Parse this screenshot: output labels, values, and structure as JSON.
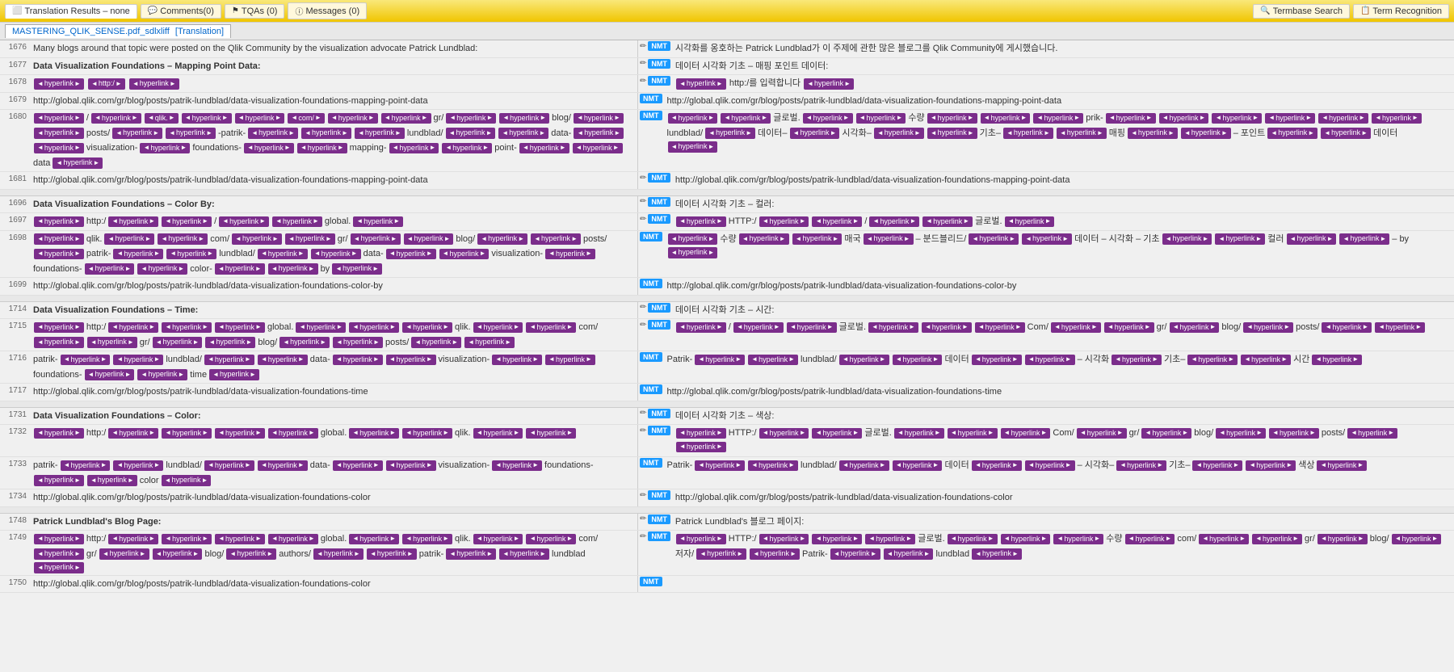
{
  "toolbar": {
    "translation_results_label": "Translation Results",
    "translation_results_value": "none",
    "comments_label": "Comments(0)",
    "tqas_label": "TQAs (0)",
    "messages_label": "Messages (0)",
    "termbase_search_label": "Termbase Search",
    "term_recognition_label": "Term Recognition"
  },
  "file_tab": {
    "name": "MASTERING_QLIK_SENSE.pdf_sdlxliff",
    "bracket_label": "[Translation]"
  },
  "colors": {
    "nmt_blue": "#1a9aff",
    "tag_purple": "#7b2d8b",
    "accent_yellow": "#f0c500",
    "toolbar_bg": "#f9e87a"
  },
  "segments": [
    {
      "group": 1,
      "rows": [
        {
          "num": "1676",
          "left_text": "Many blogs around that topic were posted on the Qlik Community by the visualization advocate Patrick Lundblad:",
          "right_icons": [
            "pencil",
            "NMT"
          ],
          "right_text": "시각화를 옹호하는 Patrick Lundblad가 이 주제에 관한 많은 블로그를 Qlik Community에 게시했습니다.",
          "has_tags": false
        },
        {
          "num": "1677",
          "left_text": "Data Visualization Foundations – Mapping Point Data:",
          "is_title": true,
          "right_icons": [
            "pencil",
            "NMT"
          ],
          "right_text": "데이터 시각화 기초 – 매핑 포인트 데이터:",
          "has_tags": false
        },
        {
          "num": "1678",
          "left_tags": [
            "hyperlink",
            "http:/",
            "hyperlink"
          ],
          "right_icons": [
            "pencil",
            "NMT"
          ],
          "right_tags": [
            "hyperlink",
            "http:/를 입력합니다",
            "hyperlink"
          ],
          "has_tags": true
        },
        {
          "num": "1679",
          "left_text": "http://global.qlik.com/gr/blog/posts/patrik-lundblad/data-visualization-foundations-mapping-point-data",
          "right_icons": [
            "NMT"
          ],
          "right_text": "http://global.qlik.com/gr/blog/posts/patrik-lundblad/data-visualization-foundations-mapping-point-data",
          "has_tags": false
        },
        {
          "num": "1680",
          "left_has_many_tags": true,
          "right_icons": [
            "NMT"
          ],
          "right_has_many_tags": true,
          "has_tags": true
        },
        {
          "num": "1681",
          "left_text": "http://global.qlik.com/gr/blog/posts/patrik-lundblad/data-visualization-foundations-mapping-point-data",
          "right_icons": [
            "pencil",
            "NMT"
          ],
          "right_text": "http://global.qlik.com/gr/blog/posts/patrik-lundblad/data-visualization-foundations-mapping-point-data",
          "has_tags": false
        }
      ]
    },
    {
      "group": 2,
      "rows": [
        {
          "num": "1696",
          "left_text": "Data Visualization Foundations – Color By:",
          "is_title": true,
          "right_icons": [
            "pencil",
            "NMT"
          ],
          "right_text": "데이터 시각화 기초 – 컬러:",
          "has_tags": false
        },
        {
          "num": "1697",
          "left_tags_text": "hyperlink http:/ hyperlink hyperlink / hyperlink hyperlink global. hyperlink",
          "right_icons": [
            "pencil",
            "NMT"
          ],
          "right_tags_text": "hyperlink HTTP:/ hyperlink hyperlink / hyperlink hyperlink 글로벌. hyperlink",
          "has_tags": true
        },
        {
          "num": "1698",
          "left_has_many_tags": true,
          "right_icons": [
            "NMT"
          ],
          "right_has_many_tags": true,
          "has_tags": true
        },
        {
          "num": "1699",
          "left_text": "http://global.qlik.com/gr/blog/posts/patrik-lundblad/data-visualization-foundations-color-by",
          "right_icons": [
            "NMT"
          ],
          "right_text": "http://global.qlik.com/gr/blog/posts/patrik-lundblad/data-visualization-foundations-color-by",
          "has_tags": false
        }
      ]
    },
    {
      "group": 3,
      "rows": [
        {
          "num": "1714",
          "left_text": "Data Visualization Foundations – Time:",
          "is_title": true,
          "right_icons": [
            "pencil",
            "NMT"
          ],
          "right_text": "데이터 시각화 기초 – 시간:",
          "has_tags": false
        },
        {
          "num": "1715",
          "left_has_many_tags": true,
          "right_icons": [
            "pencil",
            "NMT"
          ],
          "right_has_many_tags": true,
          "has_tags": true
        },
        {
          "num": "1716",
          "left_has_many_tags": true,
          "right_icons": [
            "NMT"
          ],
          "right_has_many_tags": true,
          "has_tags": true
        },
        {
          "num": "1717",
          "left_text": "http://global.qlik.com/gr/blog/posts/patrik-lundblad/data-visualization-foundations-time",
          "right_icons": [
            "NMT"
          ],
          "right_text": "http://global.qlik.com/gr/blog/posts/patrik-lundblad/data-visualization-foundations-time",
          "has_tags": false
        }
      ]
    },
    {
      "group": 4,
      "rows": [
        {
          "num": "1731",
          "left_text": "Data Visualization Foundations – Color:",
          "is_title": true,
          "right_icons": [
            "pencil",
            "NMT"
          ],
          "right_text": "데이터 시각화 기초 – 색상:",
          "has_tags": false
        },
        {
          "num": "1732",
          "left_has_many_tags": true,
          "right_icons": [
            "pencil",
            "NMT"
          ],
          "right_has_many_tags": true,
          "has_tags": true
        },
        {
          "num": "1733",
          "left_has_many_tags": true,
          "right_icons": [
            "NMT"
          ],
          "right_has_many_tags": true,
          "has_tags": true
        },
        {
          "num": "1734",
          "left_text": "http://global.qlik.com/gr/blog/posts/patrik-lundblad/data-visualization-foundations-color",
          "right_icons": [
            "pencil",
            "NMT"
          ],
          "right_text": "http://global.qlik.com/gr/blog/posts/patrik-lundblad/data-visualization-foundations-color",
          "has_tags": false
        }
      ]
    },
    {
      "group": 5,
      "rows": [
        {
          "num": "1748",
          "left_text": "Patrick Lundblad's Blog Page:",
          "is_title": true,
          "right_icons": [
            "pencil",
            "NMT"
          ],
          "right_text": "Patrick Lundblad's 블로그 페이지:",
          "has_tags": false
        },
        {
          "num": "1749",
          "left_has_many_tags": true,
          "right_icons": [
            "pencil",
            "NMT"
          ],
          "right_has_many_tags": true,
          "has_tags": true
        },
        {
          "num": "1750",
          "left_text": "http://global.qlik.com/gr/blog/posts/patrik-lundblad/data-visualization-foundations-color",
          "right_icons": [
            "NMT"
          ],
          "right_text": "",
          "has_tags": false
        }
      ]
    }
  ]
}
